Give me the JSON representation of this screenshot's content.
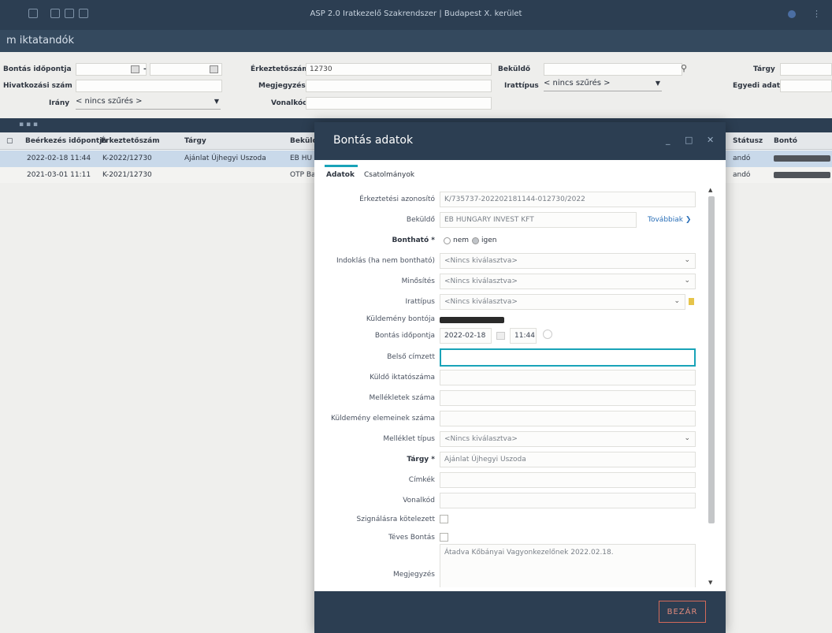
{
  "app": {
    "title": "ASP 2.0 Iratkezelő Szakrendszer | Budapest X. kerület",
    "subheader": "m iktatandók"
  },
  "filters": {
    "bontas_idopontja_label": "Bontás időpontja",
    "date_sep": "-",
    "erkeztetoszam_label": "Érkeztetőszám",
    "erkeztetoszam_value": "12730",
    "bekuldo_label": "Beküldő",
    "targy_label": "Tárgy",
    "hivatkozasi_szam_label": "Hivatkozási szám",
    "megjegyzes_label": "Megjegyzés",
    "irattipus_label": "Irattípus",
    "irattipus_value": "< nincs szűrés >",
    "egyedi_adat_label": "Egyedi adat",
    "irany_label": "Irány",
    "irany_value": "< nincs szűrés >",
    "vonalkod_label": "Vonalkód"
  },
  "grid": {
    "columns": [
      "Beérkezés időpontja",
      "Érkeztetőszám",
      "Tárgy",
      "Beküldő",
      "Státusz",
      "Bontó"
    ],
    "rows": [
      {
        "date": "2022-02-18 11:44",
        "num": "K-2022/12730",
        "subject": "Ajánlat Újhegyi Uszoda",
        "sender": "EB HU",
        "status": "andó"
      },
      {
        "date": "2021-03-01 11:11",
        "num": "K-2021/12730",
        "subject": "",
        "sender": "OTP Ba",
        "status": "andó"
      }
    ]
  },
  "modal": {
    "title": "Bontás adatok",
    "tabs": [
      "Adatok",
      "Csatolmányok"
    ],
    "fields": {
      "erkeztetesi_azonosito_label": "Érkeztetési azonosító",
      "erkeztetesi_azonosito_value": "K/735737-202202181144-012730/2022",
      "bekuldo_label": "Beküldő",
      "bekuldo_value": "EB HUNGARY INVEST KFT",
      "tovabbiak_link": "Továbbiak",
      "bonthato_label": "Bontható *",
      "bonthato_no": "nem",
      "bonthato_yes": "igen",
      "indoklas_label": "Indoklás (ha nem bontható)",
      "indoklas_value": "<Nincs kiválasztva>",
      "minosites_label": "Minősítés",
      "minosites_value": "<Nincs kiválasztva>",
      "irattipus_label": "Irattípus",
      "irattipus_value": "<Nincs kiválasztva>",
      "kuldemeny_bontoja_label": "Küldemény bontója",
      "bontas_idopontja_label": "Bontás időpontja",
      "bontas_date": "2022-02-18",
      "bontas_time": "11:44",
      "belso_cimzett_label": "Belső címzett",
      "kuldo_iktatoszama_label": "Küldő iktatószáma",
      "mellekletek_szama_label": "Mellékletek száma",
      "kuldemeny_elemeinek_szama_label": "Küldemény elemeinek száma",
      "melleklet_tipus_label": "Melléklet típus",
      "melleklet_tipus_value": "<Nincs kiválasztva>",
      "targy_label": "Tárgy *",
      "targy_value": "Ajánlat Újhegyi Uszoda",
      "cimkek_label": "Címkék",
      "vonalkod_label": "Vonalkód",
      "szignalasra_label": "Szignálásra kötelezett",
      "teves_bontas_label": "Téves Bontás",
      "megjegyzes_label": "Megjegyzés",
      "megjegyzes_value": "Átadva Kőbányai Vagyonkezelőnek 2022.02.18."
    },
    "close_label": "BEZÁR"
  }
}
